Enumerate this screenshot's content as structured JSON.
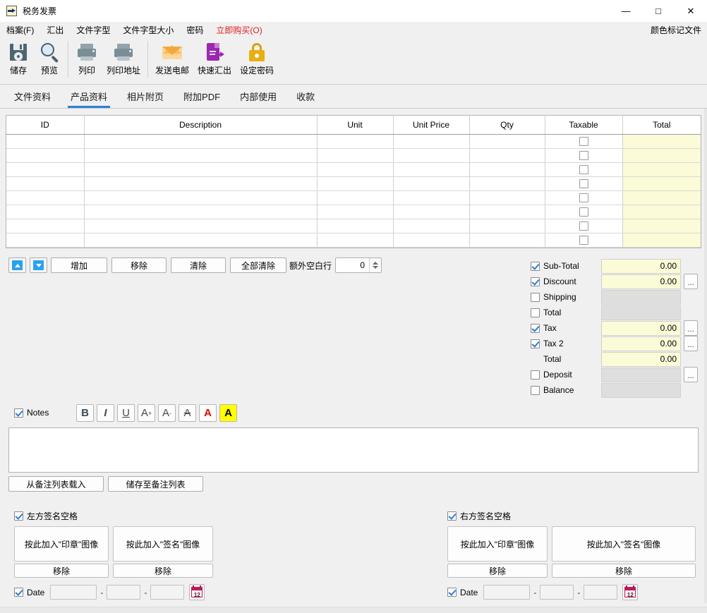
{
  "window": {
    "title": "税务发票",
    "icon": "export-doc-icon",
    "minimize": "—",
    "maximize": "□",
    "close": "✕"
  },
  "menu": {
    "items": [
      {
        "label": "档案(F)",
        "accel": "F",
        "highlight": false
      },
      {
        "label": "汇出",
        "accel": "",
        "highlight": false
      },
      {
        "label": "文件字型",
        "accel": "",
        "highlight": false
      },
      {
        "label": "文件字型大小",
        "accel": "",
        "highlight": false
      },
      {
        "label": "密码",
        "accel": "",
        "highlight": false
      },
      {
        "label": "立即购买(O)",
        "accel": "O",
        "highlight": true
      }
    ],
    "right_label": "颜色标记文件"
  },
  "toolbar": {
    "buttons": [
      {
        "label": "储存",
        "icon": "save-icon"
      },
      {
        "label": "预览",
        "icon": "preview-magnifier-icon"
      },
      {
        "label": "列印",
        "icon": "printer-icon"
      },
      {
        "label": "列印地址",
        "icon": "printer-address-icon"
      },
      {
        "label": "发送电邮",
        "icon": "email-envelope-icon"
      },
      {
        "label": "快速汇出",
        "icon": "quick-export-icon"
      },
      {
        "label": "设定密码",
        "icon": "lock-icon"
      }
    ]
  },
  "tabs": [
    {
      "label": "文件资料",
      "active": false
    },
    {
      "label": "产品资料",
      "active": true
    },
    {
      "label": "相片附页",
      "active": false
    },
    {
      "label": "附加PDF",
      "active": false
    },
    {
      "label": "内部使用",
      "active": false
    },
    {
      "label": "收款",
      "active": false
    }
  ],
  "grid": {
    "columns": [
      "ID",
      "Description",
      "Unit",
      "Unit Price",
      "Qty",
      "Taxable",
      "Total"
    ],
    "rows": [
      {
        "id": "",
        "description": "",
        "unit": "",
        "unit_price": "",
        "qty": "",
        "taxable": false,
        "total": ""
      },
      {
        "id": "",
        "description": "",
        "unit": "",
        "unit_price": "",
        "qty": "",
        "taxable": false,
        "total": ""
      },
      {
        "id": "",
        "description": "",
        "unit": "",
        "unit_price": "",
        "qty": "",
        "taxable": false,
        "total": ""
      },
      {
        "id": "",
        "description": "",
        "unit": "",
        "unit_price": "",
        "qty": "",
        "taxable": false,
        "total": ""
      },
      {
        "id": "",
        "description": "",
        "unit": "",
        "unit_price": "",
        "qty": "",
        "taxable": false,
        "total": ""
      },
      {
        "id": "",
        "description": "",
        "unit": "",
        "unit_price": "",
        "qty": "",
        "taxable": false,
        "total": ""
      },
      {
        "id": "",
        "description": "",
        "unit": "",
        "unit_price": "",
        "qty": "",
        "taxable": false,
        "total": ""
      },
      {
        "id": "",
        "description": "",
        "unit": "",
        "unit_price": "",
        "qty": "",
        "taxable": false,
        "total": ""
      }
    ]
  },
  "rowops": {
    "move_up_icon": "arrow-up-icon",
    "move_down_icon": "arrow-down-icon",
    "add": "增加",
    "remove": "移除",
    "clear": "清除",
    "clear_all": "全部清除",
    "extra_blank_label": "额外空白行",
    "extra_blank_value": "0"
  },
  "totals": {
    "rows": [
      {
        "label": "Sub-Total",
        "checked": true,
        "value": "0.00",
        "enabled": true,
        "has_dots": false,
        "show_checkbox": true
      },
      {
        "label": "Discount",
        "checked": true,
        "value": "0.00",
        "enabled": true,
        "has_dots": true,
        "show_checkbox": true
      },
      {
        "label": "Shipping",
        "checked": false,
        "value": "",
        "enabled": false,
        "has_dots": false,
        "show_checkbox": true
      },
      {
        "label": "Total",
        "checked": false,
        "value": "",
        "enabled": false,
        "has_dots": false,
        "show_checkbox": true
      },
      {
        "label": "Tax",
        "checked": true,
        "value": "0.00",
        "enabled": true,
        "has_dots": true,
        "show_checkbox": true
      },
      {
        "label": "Tax 2",
        "checked": true,
        "value": "0.00",
        "enabled": true,
        "has_dots": true,
        "show_checkbox": true
      },
      {
        "label": "Total",
        "checked": false,
        "value": "0.00",
        "enabled": true,
        "has_dots": false,
        "show_checkbox": false
      },
      {
        "label": "Deposit",
        "checked": false,
        "value": "",
        "enabled": false,
        "has_dots": true,
        "show_checkbox": true
      },
      {
        "label": "Balance",
        "checked": false,
        "value": "",
        "enabled": false,
        "has_dots": false,
        "show_checkbox": true
      }
    ],
    "dots_label": "..."
  },
  "notes": {
    "label": "Notes",
    "checked": true,
    "value": "",
    "format_buttons": [
      {
        "name": "bold-button",
        "glyph": "B",
        "style": "bold"
      },
      {
        "name": "italic-button",
        "glyph": "I",
        "style": "italic"
      },
      {
        "name": "underline-button",
        "glyph": "U",
        "style": "underline"
      },
      {
        "name": "font-increase-button",
        "glyph": "A+",
        "style": "plain"
      },
      {
        "name": "font-decrease-button",
        "glyph": "A-",
        "style": "plain"
      },
      {
        "name": "strikethrough-button",
        "glyph": "A",
        "style": "strike"
      },
      {
        "name": "font-color-button",
        "glyph": "A",
        "style": "red"
      },
      {
        "name": "highlight-color-button",
        "glyph": "A",
        "style": "highlight"
      }
    ],
    "load_button": "从备注列表载入",
    "save_button": "储存至备注列表"
  },
  "signatures": {
    "left": {
      "label": "左方签名空格",
      "checked": true,
      "stamp_button": "按此加入\"印章\"图像",
      "sign_button": "按此加入\"签名\"图像",
      "remove_button": "移除",
      "date_label": "Date",
      "date_checked": true,
      "date_parts": [
        "",
        "",
        ""
      ],
      "separator": "-",
      "calendar_icon": "calendar-icon",
      "calendar_day": "12"
    },
    "right": {
      "label": "右方签名空格",
      "checked": true,
      "stamp_button": "按此加入\"印章\"图像",
      "sign_button": "按此加入\"签名\"图像",
      "remove_button": "移除",
      "date_label": "Date",
      "date_checked": true,
      "date_parts": [
        "",
        "",
        ""
      ],
      "separator": "-",
      "calendar_icon": "calendar-icon",
      "calendar_day": "12"
    }
  },
  "colors": {
    "accent": "#2f7fd1",
    "buy_now": "#e01b1b",
    "editable_field": "#fbfbd7",
    "disabled_field": "#dedede",
    "window_bg": "#f0f0f0"
  }
}
